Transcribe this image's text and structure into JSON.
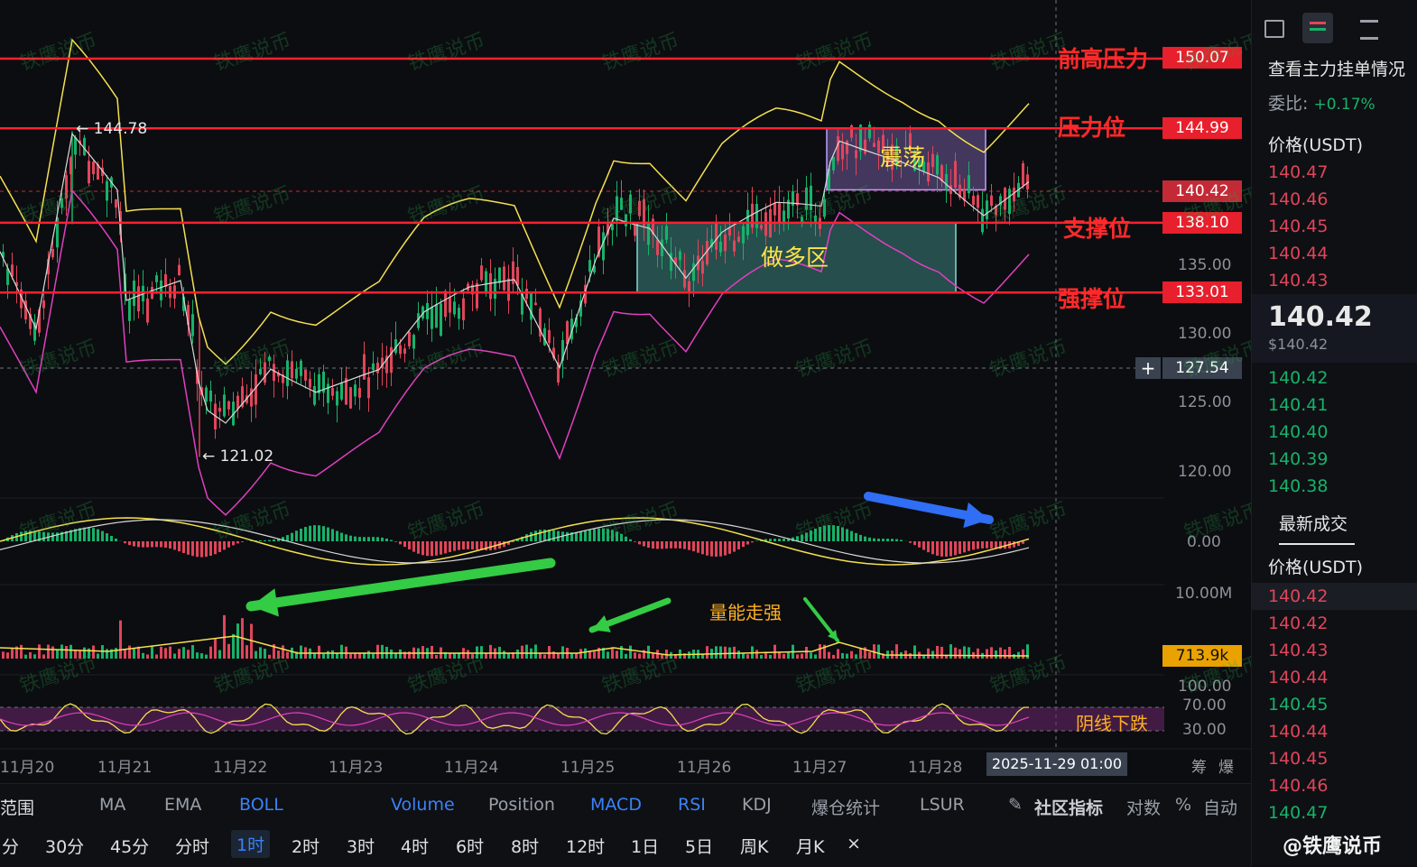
{
  "chart_data": {
    "type": "candlestick",
    "title": "",
    "x_dates": [
      "11月20",
      "11月21",
      "11月22",
      "11月23",
      "11月24",
      "11月25",
      "11月26",
      "11月27",
      "11月28"
    ],
    "y_ticks": [
      "135.00",
      "130.00",
      "125.00",
      "120.00"
    ],
    "ylim": [
      117,
      152
    ],
    "horizontal_levels": [
      {
        "label": "前高压力",
        "value": 150.07
      },
      {
        "label": "压力位",
        "value": 144.99
      },
      {
        "label": "支撑位",
        "value": 138.1
      },
      {
        "label": "强撑位",
        "value": 133.01
      }
    ],
    "current_price": 140.42,
    "crosshair_price": 127.54,
    "crosshair_time": "2025-11-29 01:00",
    "high_marker": "144.78",
    "low_marker": "121.02",
    "zones": [
      {
        "label": "做多区",
        "from": 133.01,
        "to": 138.1
      },
      {
        "label": "震荡",
        "from": 140.5,
        "to": 144.99
      }
    ],
    "macd_zero": "0.00",
    "volume_axis": "10.00M",
    "volume_current": "713.9k",
    "volume_note": "量能走强",
    "rsi_ticks": [
      "100.00",
      "70.00",
      "30.00"
    ],
    "rsi_note": "阴线下跌"
  },
  "side_panel": {
    "title": "查看主力挂单情况",
    "ratio_label": "委比:",
    "ratio_value": "+0.17%",
    "price_header": "价格(USDT)",
    "asks": [
      "140.47",
      "140.46",
      "140.45",
      "140.44",
      "140.43"
    ],
    "last_price": "140.42",
    "last_price_usd": "$140.42",
    "bids": [
      "140.42",
      "140.41",
      "140.40",
      "140.39",
      "140.38"
    ],
    "trades_title": "最新成交",
    "trades_header": "价格(USDT)",
    "trades": [
      {
        "p": "140.42",
        "c": "ask"
      },
      {
        "p": "140.42",
        "c": "ask"
      },
      {
        "p": "140.43",
        "c": "ask"
      },
      {
        "p": "140.44",
        "c": "ask"
      },
      {
        "p": "140.45",
        "c": "bid"
      },
      {
        "p": "140.44",
        "c": "ask"
      },
      {
        "p": "140.45",
        "c": "ask"
      },
      {
        "p": "140.46",
        "c": "ask"
      },
      {
        "p": "140.47",
        "c": "bid"
      }
    ],
    "brand": "@铁鹰说币"
  },
  "toolbar": {
    "row1": [
      "范围",
      "MA",
      "EMA",
      "BOLL",
      "Volume",
      "Position",
      "MACD",
      "RSI",
      "KDJ",
      "爆仓统计",
      "LSUR",
      "社区指标",
      "对数",
      "%",
      "自动"
    ],
    "row2": [
      "分",
      "30分",
      "45分",
      "分时",
      "1时",
      "2时",
      "3时",
      "4时",
      "6时",
      "8时",
      "12时",
      "1日",
      "5日",
      "周K",
      "月K",
      "×"
    ],
    "active_interval": "1时",
    "corner": [
      "筹",
      "爆"
    ]
  },
  "watermark": "铁鹰说币"
}
